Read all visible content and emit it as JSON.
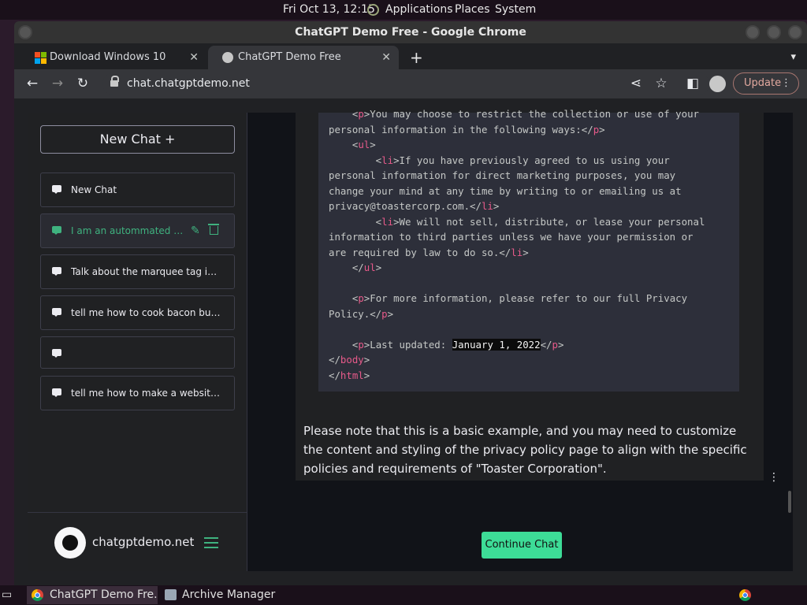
{
  "top_panel": {
    "clock": "Fri Oct 13, 12:15",
    "menus": [
      "Applications",
      "Places",
      "System"
    ]
  },
  "window": {
    "title": "ChatGPT Demo Free - Google Chrome"
  },
  "tabs": [
    {
      "label": "Download Windows 10",
      "active": false
    },
    {
      "label": "ChatGPT Demo Free",
      "active": true
    }
  ],
  "toolbar": {
    "url": "chat.chatgptdemo.net",
    "update_label": "Update"
  },
  "sidebar": {
    "new_chat_label": "New Chat +",
    "items": [
      {
        "label": "New Chat"
      },
      {
        "label": "I am an autommated script"
      },
      {
        "label": "Talk about the marquee tag in greater detail"
      },
      {
        "label": "tell me how to cook bacon but write it like"
      },
      {
        "label": ""
      },
      {
        "label": "tell me how to make a website but write it"
      }
    ],
    "site_name": "chatgptdemo.net"
  },
  "chat": {
    "code_lines": [
      [
        [
          "    <",
          ""
        ],
        [
          "p",
          "tg"
        ],
        [
          ">You may choose to restrict the collection or use of your",
          ""
        ]
      ],
      [
        [
          "personal information in the following ways:</",
          ""
        ],
        [
          "p",
          "tg"
        ],
        [
          ">",
          ""
        ]
      ],
      [
        [
          "    <",
          ""
        ],
        [
          "ul",
          "tg"
        ],
        [
          ">",
          ""
        ]
      ],
      [
        [
          "        <",
          ""
        ],
        [
          "li",
          "tg"
        ],
        [
          ">If you have previously agreed to us using your",
          ""
        ]
      ],
      [
        [
          "personal information for direct marketing purposes, you may",
          ""
        ]
      ],
      [
        [
          "change your mind at any time by writing to or emailing us at",
          ""
        ]
      ],
      [
        [
          "privacy@toastercorp.com.</",
          ""
        ],
        [
          "li",
          "tg"
        ],
        [
          ">",
          ""
        ]
      ],
      [
        [
          "        <",
          ""
        ],
        [
          "li",
          "tg"
        ],
        [
          ">We will not sell, distribute, or lease your personal",
          ""
        ]
      ],
      [
        [
          "information to third parties unless we have your permission or",
          ""
        ]
      ],
      [
        [
          "are required by law to do so.</",
          ""
        ],
        [
          "li",
          "tg"
        ],
        [
          ">",
          ""
        ]
      ],
      [
        [
          "    </",
          ""
        ],
        [
          "ul",
          "tg"
        ],
        [
          ">",
          ""
        ]
      ],
      [
        [
          "",
          ""
        ]
      ],
      [
        [
          "    <",
          ""
        ],
        [
          "p",
          "tg"
        ],
        [
          ">For more information, please refer to our full Privacy",
          ""
        ]
      ],
      [
        [
          "Policy.</",
          ""
        ],
        [
          "p",
          "tg"
        ],
        [
          ">",
          ""
        ]
      ],
      [
        [
          "",
          ""
        ]
      ],
      [
        [
          "    <",
          ""
        ],
        [
          "p",
          "tg"
        ],
        [
          ">Last updated: ",
          ""
        ],
        [
          "January 1, 2022",
          "sel"
        ],
        [
          "</",
          ""
        ],
        [
          "p",
          "tg"
        ],
        [
          ">",
          ""
        ]
      ],
      [
        [
          "</",
          ""
        ],
        [
          "body",
          "tg"
        ],
        [
          ">",
          ""
        ]
      ],
      [
        [
          "</",
          ""
        ],
        [
          "html",
          "tg"
        ],
        [
          ">",
          ""
        ]
      ]
    ],
    "prose": "Please note that this is a basic example, and you may need to customize the content and styling of the privacy policy page to align with the specific policies and requirements of \"Toaster Corporation\".",
    "continue_label": "Continue Chat"
  },
  "taskbar": {
    "items": [
      {
        "label": "ChatGPT Demo Fre..."
      },
      {
        "label": "Archive Manager"
      }
    ]
  },
  "colors": {
    "accent_green": "#3ddc97",
    "tag_pink": "#e75a8a",
    "sidebar_bg": "#202123"
  }
}
